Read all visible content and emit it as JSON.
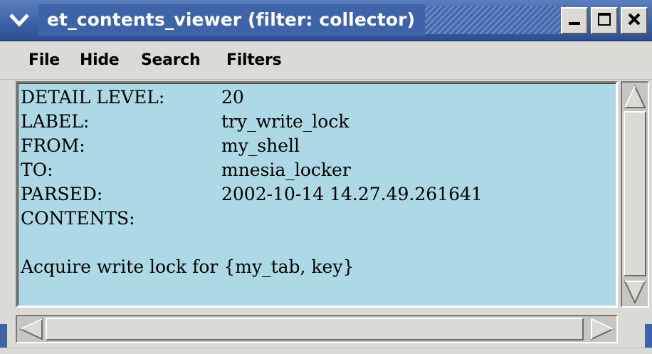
{
  "window": {
    "title": "et_contents_viewer (filter: collector)",
    "accent_color": "#3e63a8",
    "controls": {
      "menu_icon": "chevron-down-icon",
      "minimize_icon": "minimize-icon",
      "maximize_icon": "maximize-icon",
      "close_icon": "close-icon"
    }
  },
  "menubar": {
    "items": [
      "File",
      "Hide",
      "Search",
      "Filters"
    ]
  },
  "content": {
    "background_color": "#add8e6",
    "fields": [
      {
        "label": "DETAIL LEVEL:",
        "value": "20"
      },
      {
        "label": "LABEL:",
        "value": "try_write_lock"
      },
      {
        "label": "FROM:",
        "value": "my_shell"
      },
      {
        "label": "TO:",
        "value": "mnesia_locker"
      },
      {
        "label": "PARSED:",
        "value": "2002-10-14 14.27.49.261641"
      },
      {
        "label": "CONTENTS:",
        "value": ""
      }
    ],
    "body_text": "Acquire write lock for {my_tab, key}"
  },
  "scrollbars": {
    "vertical": {
      "up_icon": "arrow-up-icon",
      "down_icon": "arrow-down-icon"
    },
    "horizontal": {
      "left_icon": "arrow-left-icon",
      "right_icon": "arrow-right-icon"
    }
  }
}
